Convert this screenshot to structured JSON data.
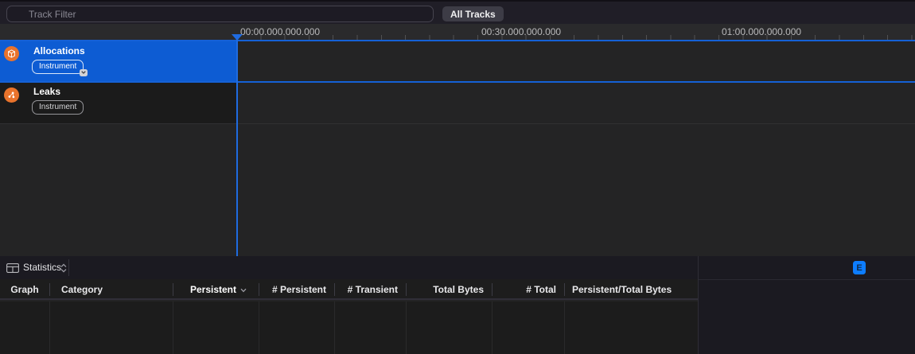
{
  "toolbar": {
    "filter_placeholder": "Track Filter",
    "all_tracks_label": "All Tracks"
  },
  "timeline": {
    "ruler_labels": [
      "00:00.000.000.000",
      "00:30.000.000.000",
      "01:00.000.000.000"
    ],
    "tracks": [
      {
        "name": "Allocations",
        "badge": "Instrument",
        "selected": true
      },
      {
        "name": "Leaks",
        "badge": "Instrument",
        "selected": false
      }
    ]
  },
  "detail_area": {
    "view_selector_label": "Statistics",
    "inspector_badge": "E",
    "table": {
      "columns": [
        {
          "label": "Graph",
          "align": "center"
        },
        {
          "label": "Category",
          "align": "left"
        },
        {
          "label": "Persistent",
          "align": "right",
          "sorted": true,
          "sort_indicator": "down"
        },
        {
          "label": "# Persistent",
          "align": "right"
        },
        {
          "label": "# Transient",
          "align": "right"
        },
        {
          "label": "Total Bytes",
          "align": "right"
        },
        {
          "label": "# Total",
          "align": "right"
        },
        {
          "label": "Persistent/Total Bytes",
          "align": "left"
        }
      ],
      "rows": []
    }
  },
  "colors": {
    "selection_blue": "#0d5cd3",
    "playhead_blue": "#1f6be0",
    "instrument_orange": "#e9732c",
    "inspector_badge_blue": "#0d7dff",
    "toolbar_bg": "#201e27",
    "detail_bg": "#1b1a21"
  }
}
